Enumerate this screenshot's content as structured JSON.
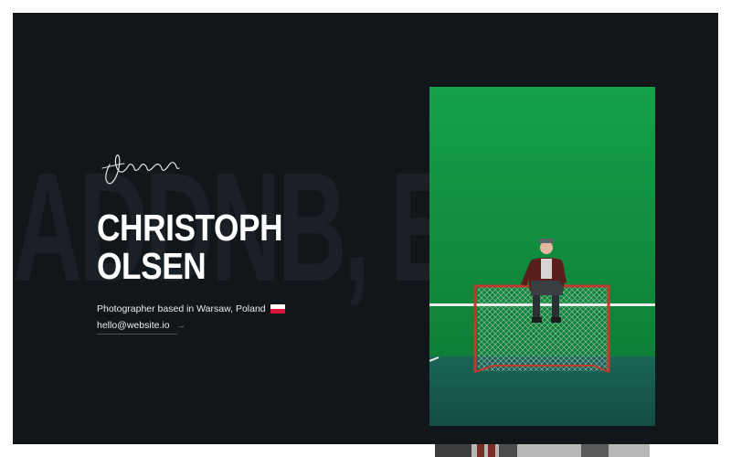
{
  "hero": {
    "background_word": "ADDNB, E, V",
    "name_line1": "CHRISTOPH",
    "name_line2": "OLSEN",
    "tagline": "Photographer based in Warsaw, Poland",
    "email": "hello@website.io",
    "arrow_icon": "arrow-right-icon",
    "flag_icon": "poland-flag-icon",
    "signature_icon": "signature-icon"
  },
  "photo": {
    "subject": "hockey-net-portrait",
    "colors": {
      "wall": "#12903f",
      "floor": "#16574c",
      "net_frame": "#c23a2c"
    }
  },
  "colors": {
    "page_bg": "#ffffff",
    "panel_bg": "#11161a",
    "text": "#ffffff"
  }
}
